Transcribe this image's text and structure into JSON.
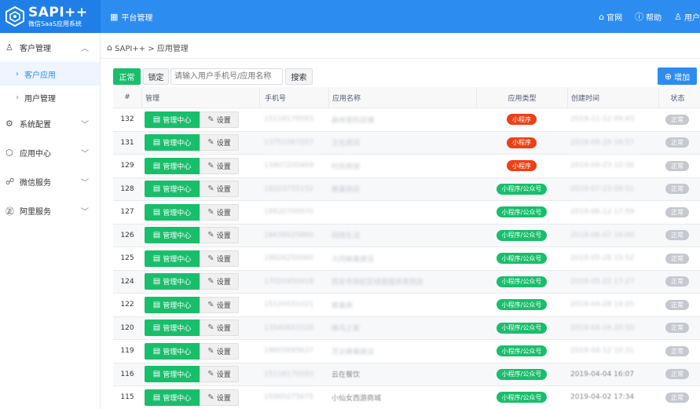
{
  "app": {
    "title": "SAPI++",
    "subtitle": "微信SaaS应用系统"
  },
  "header": {
    "platform_tab": "平台管理",
    "links": [
      {
        "label": "官网",
        "icon": "home-icon"
      },
      {
        "label": "帮助",
        "icon": "help-icon"
      },
      {
        "label": "用户",
        "icon": "user-icon"
      }
    ]
  },
  "sidebar": {
    "customer": "客户管理",
    "customer_app": "客户应用",
    "user_mgmt": "用户管理",
    "system": "系统配置",
    "app_center": "应用中心",
    "wechat": "微信服务",
    "aliyun": "阿里服务"
  },
  "breadcrumb": "SAPI++ > 应用管理",
  "toolbar": {
    "normal": "正常",
    "lock": "锁定",
    "search_placeholder": "请输入用户手机号/应用名称",
    "search": "搜索",
    "add": "增加"
  },
  "table": {
    "headers": {
      "id": "#",
      "manage": "管理",
      "phone": "手机号",
      "name": "应用名称",
      "type": "应用类型",
      "time": "创建时间",
      "status": "状态"
    },
    "manage_label": "管理中心",
    "settings_label": "设置",
    "rows": [
      {
        "id": "132",
        "phone": "15118179593",
        "name": "森林里的店铺",
        "type": "小程序",
        "type_color": "red",
        "time": "2019-11-12 09:43",
        "status": "正常"
      },
      {
        "id": "131",
        "phone": "13751067207",
        "name": "文化资讯",
        "type": "小程序",
        "type_color": "red",
        "time": "2019-09-29 16:57",
        "status": "正常"
      },
      {
        "id": "129",
        "phone": "13807200469",
        "name": "时尚商城",
        "type": "小程序",
        "type_color": "red",
        "time": "2019-09-23 10:36",
        "status": "正常"
      },
      {
        "id": "128",
        "phone": "18103755152",
        "name": "蜂巢商店",
        "type": "小程序/公众号",
        "type_color": "green",
        "time": "2019-07-23 09:51",
        "status": "正常"
      },
      {
        "id": "127",
        "phone": "18820709970",
        "name": "",
        "type": "小程序/公众号",
        "type_color": "green",
        "time": "2019-06-12 17:59",
        "status": "正常"
      },
      {
        "id": "126",
        "phone": "16639025860",
        "name": "网络生活",
        "type": "小程序/公众号",
        "type_color": "green",
        "time": "2019-06-07 16:00",
        "status": "正常"
      },
      {
        "id": "125",
        "phone": "18826250060",
        "name": "大同蜂巢建设",
        "type": "小程序/公众号",
        "type_color": "green",
        "time": "2019-05-28 15:52",
        "status": "正常"
      },
      {
        "id": "124",
        "phone": "17020450418",
        "name": "西安市雨虹区绿壹服务商贸店",
        "type": "小程序/公众号",
        "type_color": "green",
        "time": "2019-05-22 17:27",
        "status": "正常"
      },
      {
        "id": "122",
        "phone": "15120031021",
        "name": "蜂巢商",
        "type": "小程序/公众号",
        "type_color": "green",
        "time": "2019-04-28 14:05",
        "status": "正常"
      },
      {
        "id": "120",
        "phone": "13540653320",
        "name": "蜂鸟之家",
        "type": "小程序/公众号",
        "type_color": "green",
        "time": "2019-04-16 20:50",
        "status": "正常"
      },
      {
        "id": "119",
        "phone": "18605695637",
        "name": "灵云蜂巢建设",
        "type": "小程序/公众号",
        "type_color": "green",
        "time": "2019-04-12 10:31",
        "status": "正常"
      },
      {
        "id": "116",
        "phone": "15118179593",
        "name": "云在餐饮",
        "type": "小程序/公众号",
        "type_color": "green",
        "time": "2019-04-04 16:07",
        "status": "正常"
      },
      {
        "id": "115",
        "phone": "15995075675",
        "name": "小仙女西游商城",
        "type": "小程序/公众号",
        "type_color": "green",
        "time": "2019-04-02 17:34",
        "status": "正常"
      }
    ]
  }
}
